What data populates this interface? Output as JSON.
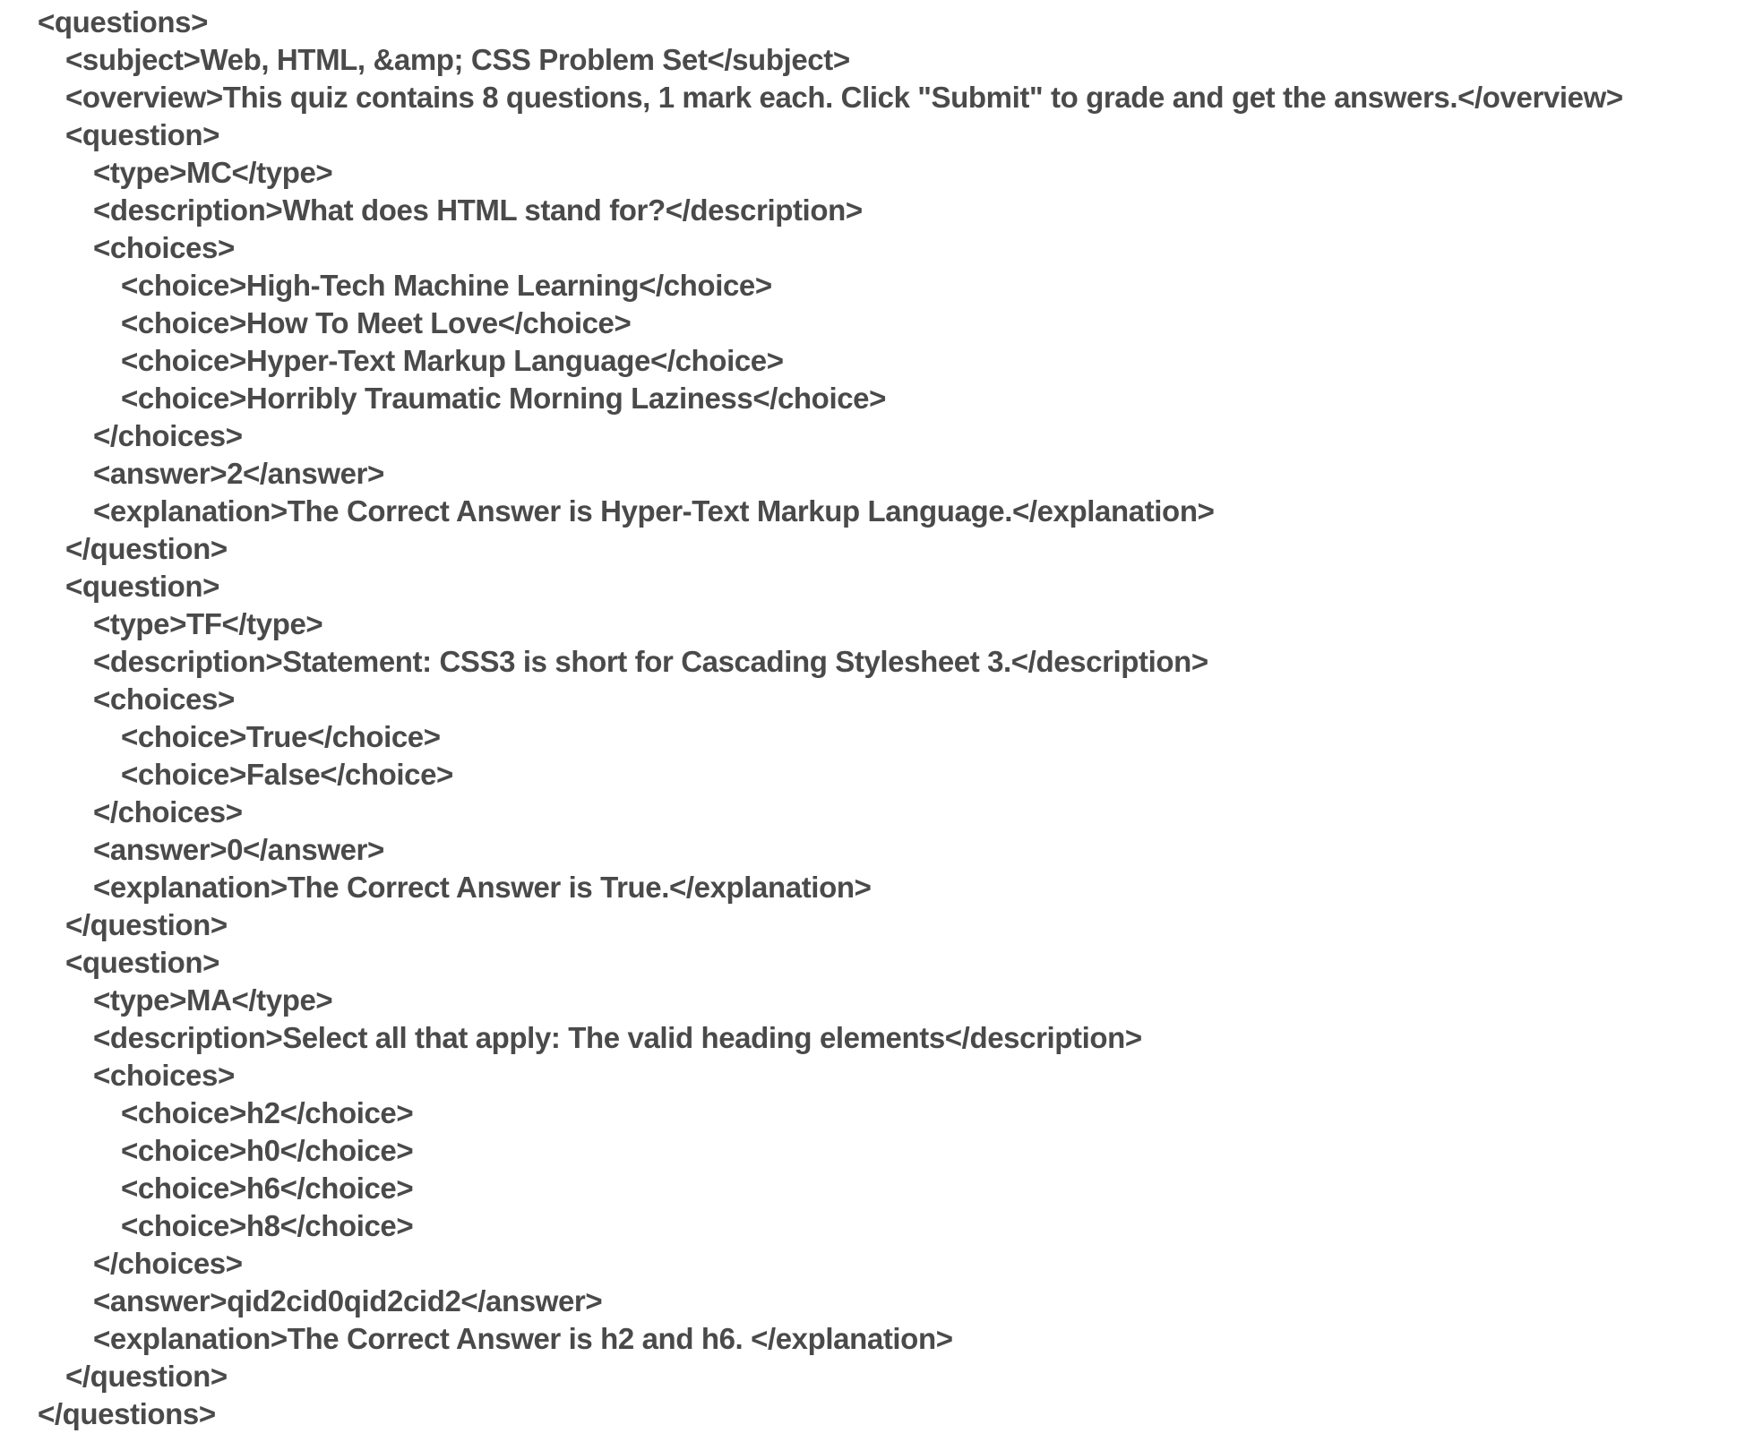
{
  "xml_lines": [
    {
      "depth": 0,
      "text": "<questions>"
    },
    {
      "depth": 1,
      "text": "<subject>Web, HTML, &amp; CSS Problem Set</subject>"
    },
    {
      "depth": 1,
      "text": "<overview>This quiz contains 8 questions, 1 mark each. Click \"Submit\" to grade and get the answers.</overview>"
    },
    {
      "depth": 1,
      "text": "<question>"
    },
    {
      "depth": 2,
      "text": "<type>MC</type>"
    },
    {
      "depth": 2,
      "text": "<description>What does HTML stand for?</description>"
    },
    {
      "depth": 2,
      "text": "<choices>"
    },
    {
      "depth": 3,
      "text": "<choice>High-Tech Machine Learning</choice>"
    },
    {
      "depth": 3,
      "text": "<choice>How To Meet Love</choice>"
    },
    {
      "depth": 3,
      "text": "<choice>Hyper-Text Markup Language</choice>"
    },
    {
      "depth": 3,
      "text": "<choice>Horribly Traumatic Morning Laziness</choice>"
    },
    {
      "depth": 2,
      "text": "</choices>"
    },
    {
      "depth": 2,
      "text": "<answer>2</answer>"
    },
    {
      "depth": 2,
      "text": "<explanation>The Correct Answer is Hyper-Text Markup Language.</explanation>"
    },
    {
      "depth": 1,
      "text": "</question>"
    },
    {
      "depth": 1,
      "text": "<question>"
    },
    {
      "depth": 2,
      "text": "<type>TF</type>"
    },
    {
      "depth": 2,
      "text": "<description>Statement: CSS3 is short for Cascading Stylesheet 3.</description>"
    },
    {
      "depth": 2,
      "text": "<choices>"
    },
    {
      "depth": 3,
      "text": "<choice>True</choice>"
    },
    {
      "depth": 3,
      "text": "<choice>False</choice>"
    },
    {
      "depth": 2,
      "text": "</choices>"
    },
    {
      "depth": 2,
      "text": "<answer>0</answer>"
    },
    {
      "depth": 2,
      "text": "<explanation>The Correct Answer is True.</explanation>"
    },
    {
      "depth": 1,
      "text": "</question>"
    },
    {
      "depth": 1,
      "text": "<question>"
    },
    {
      "depth": 2,
      "text": "<type>MA</type>"
    },
    {
      "depth": 2,
      "text": "<description>Select all that apply: The valid heading elements</description>"
    },
    {
      "depth": 2,
      "text": "<choices>"
    },
    {
      "depth": 3,
      "text": "<choice>h2</choice>"
    },
    {
      "depth": 3,
      "text": "<choice>h0</choice>"
    },
    {
      "depth": 3,
      "text": "<choice>h6</choice>"
    },
    {
      "depth": 3,
      "text": "<choice>h8</choice>"
    },
    {
      "depth": 2,
      "text": "</choices>"
    },
    {
      "depth": 2,
      "text": "<answer>qid2cid0qid2cid2</answer>"
    },
    {
      "depth": 2,
      "text": "<explanation>The Correct Answer is h2 and h6. </explanation>"
    },
    {
      "depth": 1,
      "text": "</question>"
    },
    {
      "depth": 0,
      "text": "</questions>"
    }
  ],
  "colors": {
    "text": "#4a4a4a",
    "background": "#ffffff"
  }
}
